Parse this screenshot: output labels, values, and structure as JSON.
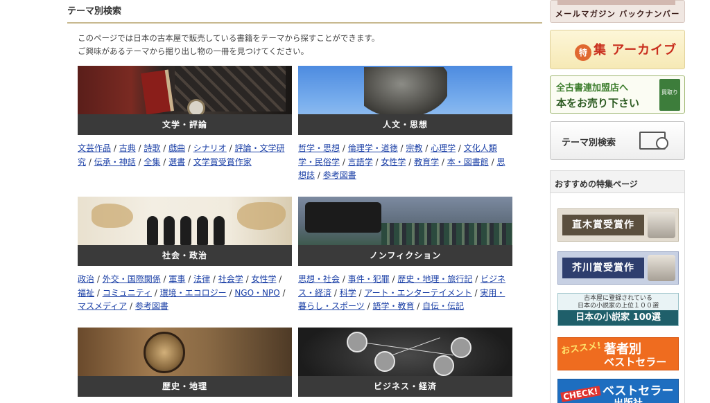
{
  "page": {
    "section_title": "テーマ別検索",
    "intro": [
      "このページでは日本の古本屋で販売している書籍をテーマから探すことができます。",
      "ご興味があるテーマから掘り出し物の一冊を見つけてください。"
    ]
  },
  "themes": [
    {
      "title": "文学・評論",
      "links": [
        "文芸作品",
        "古典",
        "詩歌",
        "戯曲",
        "シナリオ",
        "評論・文学研究",
        "伝承・神話",
        "全集",
        "選書",
        "文学賞受賞作家"
      ]
    },
    {
      "title": "人文・思想",
      "links": [
        "哲学・思想",
        "倫理学・道徳",
        "宗教",
        "心理学",
        "文化人類学・民俗学",
        "言語学",
        "女性学",
        "教育学",
        "本・図書館",
        "思想誌",
        "参考図書"
      ]
    },
    {
      "title": "社会・政治",
      "links": [
        "政治",
        "外交・国際関係",
        "軍事",
        "法律",
        "社会学",
        "女性学",
        "福祉",
        "コミュニティ",
        "環境・エコロジー",
        "NGO・NPO",
        "マスメディア",
        "参考図書"
      ]
    },
    {
      "title": "ノンフィクション",
      "links": [
        "思想・社会",
        "事件・犯罪",
        "歴史・地理・旅行記",
        "ビジネス・経済",
        "科学",
        "アート・エンターテイメント",
        "実用・暮らし・スポーツ",
        "語学・教育",
        "自伝・伝記"
      ]
    },
    {
      "title": "歴史・地理",
      "links": []
    },
    {
      "title": "ビジネス・経済",
      "links": []
    }
  ],
  "sidebar": {
    "mailmag": "メールマガジン バックナンバー",
    "archive_toku": "特",
    "archive_label": "集 アーカイブ",
    "sell_line1": "全古書連加盟店へ",
    "sell_line2": "本をお売り下さい",
    "sell_box": "買取り",
    "theme_search": "テーマ別検索",
    "recommend_title": "おすすめの特集ページ",
    "naoki": "直木賞受賞作",
    "akutagawa": "芥川賞受賞作",
    "novel_small": "古本屋に登録されている\n日本の小説家の上位１００選",
    "novel_main": "日本の小説家 100選",
    "author_osusume": "おススメ!",
    "author_l1": "著者別",
    "author_l2": "ベストセラー",
    "pub_check": "CHECK!",
    "pub_l1": "ベストセラー",
    "pub_l2": "出版社"
  }
}
